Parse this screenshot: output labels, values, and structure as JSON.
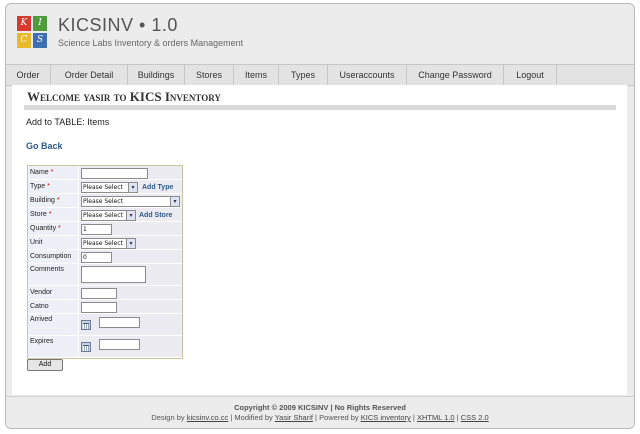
{
  "colors": {
    "logo_red": "#d73b2f",
    "logo_blue": "#3d6fb2",
    "logo_green": "#4f9d3a",
    "logo_yellow": "#e8b92b",
    "link": "#2d5a8a",
    "required": "#cc0000"
  },
  "header": {
    "logo_letters": [
      "K",
      "I",
      "C",
      "S"
    ],
    "title": "KICSINV • 1.0",
    "subtitle": "Science Labs Inventory & orders Management"
  },
  "nav": {
    "items": [
      "Order",
      "Order Detail",
      "Buildings",
      "Stores",
      "Items",
      "Types",
      "Useraccounts",
      "Change Password",
      "Logout"
    ]
  },
  "main": {
    "welcome": "Welcome yasir to KICS Inventory",
    "add_to": "Add to TABLE: Items",
    "go_back": "Go Back",
    "form": {
      "name_label": "Name",
      "type_label": "Type",
      "type_value": "Please Select",
      "add_type": "Add Type",
      "building_label": "Building",
      "building_value": "Please Select",
      "store_label": "Store",
      "store_value": "Please Select",
      "add_store": "Add Store",
      "quantity_label": "Quantity",
      "quantity_value": "1",
      "unit_label": "Unit",
      "unit_value": "Please Select",
      "consumption_label": "Consumption",
      "consumption_value": "0",
      "comments_label": "Comments",
      "vendor_label": "Vendor",
      "catno_label": "Catno",
      "arrived_label": "Arrived",
      "expires_label": "Expires",
      "required_mark": "*",
      "submit_label": "Add",
      "dropdown_arrow": "▾"
    }
  },
  "footer": {
    "copyright": "Copyright © 2009 KICSINV | No Rights Reserved",
    "design_by": "Design by",
    "design_link": "kicsinv.co.cc",
    "modified_by": "| Modified by",
    "modified_link": "Yasir Sharif",
    "powered_by": "| Powered by",
    "powered_link": "KICS inventory",
    "sep1": "|",
    "xhtml_link": "XHTML 1.0",
    "sep2": "|",
    "css_link": "CSS 2.0"
  }
}
